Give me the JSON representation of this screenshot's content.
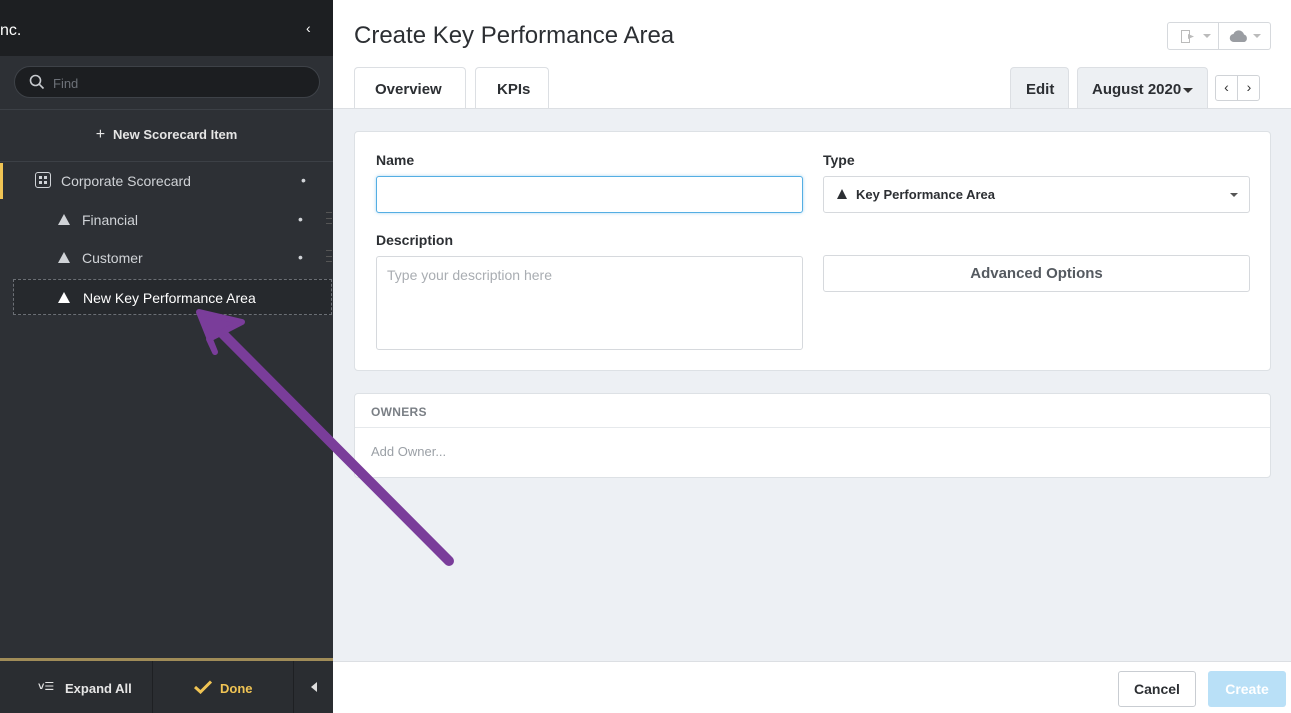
{
  "sidebar": {
    "title": "nc.",
    "search_placeholder": "Find",
    "new_item_label": "New Scorecard Item",
    "tree": [
      {
        "label": "Corporate Scorecard",
        "dot": "•"
      },
      {
        "label": "Financial",
        "dot": "•"
      },
      {
        "label": "Customer",
        "dot": "•"
      },
      {
        "label": "New Key Performance Area"
      }
    ],
    "expand_all_label": "Expand All",
    "done_label": "Done"
  },
  "header": {
    "title": "Create Key Performance Area"
  },
  "tabs": {
    "overview": "Overview",
    "kpis": "KPIs",
    "edit": "Edit",
    "month": "August 2020",
    "prev": "‹",
    "next": "›"
  },
  "form": {
    "name_label": "Name",
    "name_value": "",
    "type_label": "Type",
    "type_value": "Key Performance Area",
    "description_label": "Description",
    "description_placeholder": "Type your description here",
    "advanced_options_label": "Advanced Options"
  },
  "owners": {
    "heading": "OWNERS",
    "add_label": "Add Owner..."
  },
  "footer": {
    "cancel_label": "Cancel",
    "create_label": "Create"
  },
  "colors": {
    "sidebar_bg": "#2d3035",
    "accent_yellow": "#f0c454",
    "input_focus": "#55aee3",
    "create_disabled": "#b9e0f7",
    "annotation_arrow": "#7a3d9a"
  }
}
